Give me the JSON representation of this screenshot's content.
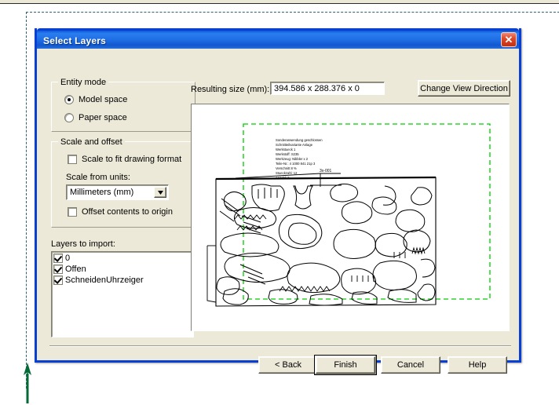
{
  "window": {
    "title": "Select Layers",
    "close_label": "✕"
  },
  "entity_mode": {
    "group_label": "Entity mode",
    "options": [
      {
        "label": "Model space",
        "selected": true
      },
      {
        "label": "Paper space",
        "selected": false
      }
    ]
  },
  "scale_and_offset": {
    "group_label": "Scale and offset",
    "scale_to_fit": {
      "label": "Scale to fit drawing format",
      "checked": false
    },
    "scale_from_units_label": "Scale from units:",
    "units_value": "Millimeters (mm)",
    "units_arrow": "▼",
    "offset_to_origin": {
      "label": "Offset contents to origin",
      "checked": false
    }
  },
  "layers": {
    "label": "Layers to import:",
    "items": [
      {
        "label": "0",
        "checked": true
      },
      {
        "label": "Offen",
        "checked": true
      },
      {
        "label": "SchneidenUhrzeiger",
        "checked": true
      }
    ]
  },
  "preview": {
    "resulting_size_label": "Resulting size (mm):",
    "resulting_size_value": "394.586 x 288.376 x 0",
    "change_view_label": "Change View Direction",
    "boundary_color": "#00cc00",
    "drawing_color": "#000000",
    "annotation_tag": "3x-001"
  },
  "footer": {
    "back_label": "< Back",
    "finish_label": "Finish",
    "cancel_label": "Cancel",
    "help_label": "Help"
  },
  "canvas": {
    "marquee_color": "#2f5f70",
    "arrow_color": "#046a38"
  }
}
